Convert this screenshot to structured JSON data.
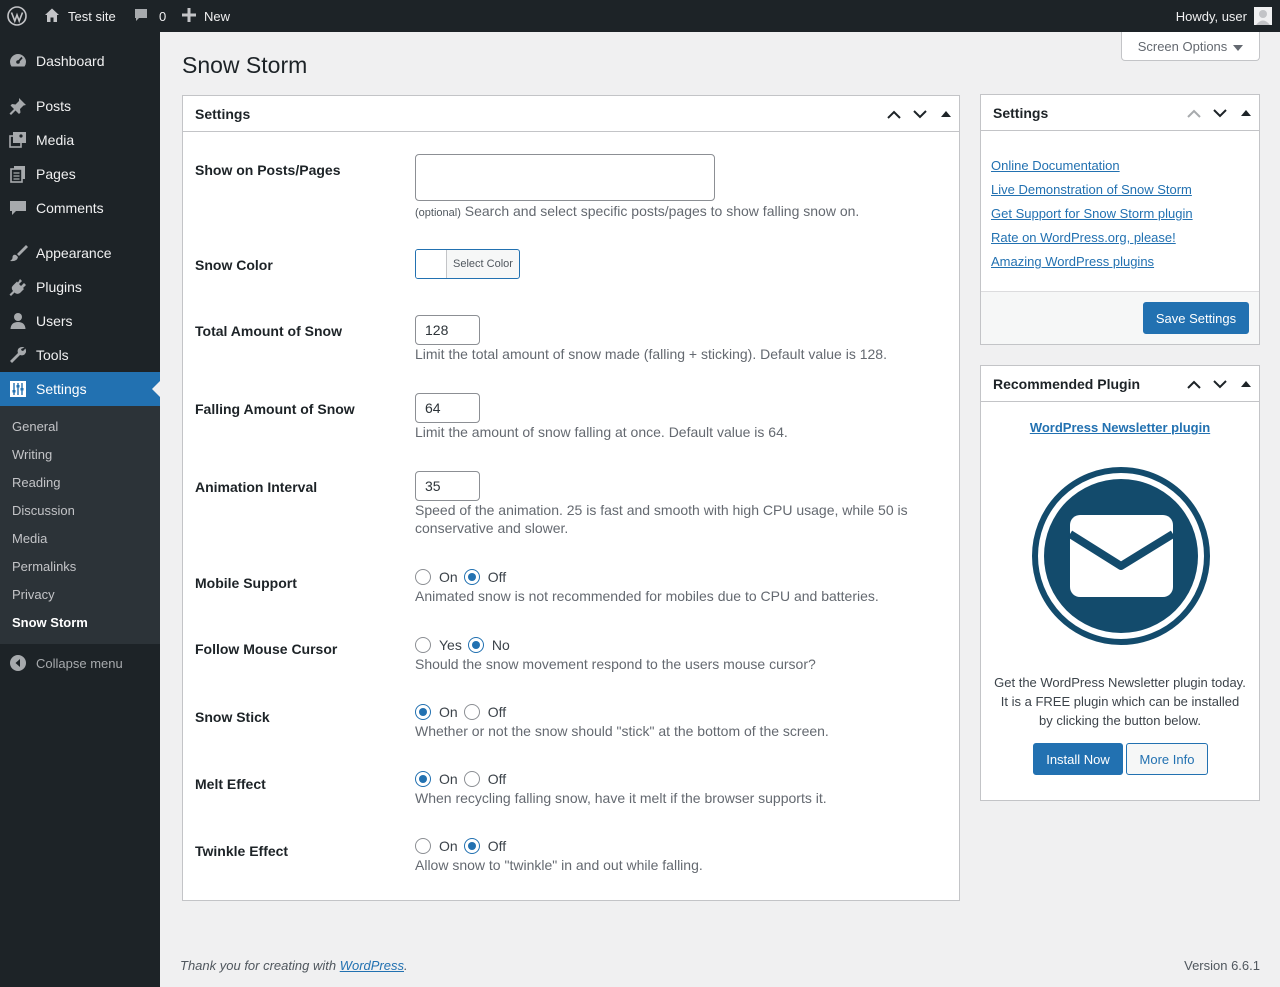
{
  "adminbar": {
    "site_name": "Test site",
    "comments_count": "0",
    "new_label": "New",
    "howdy": "Howdy, user"
  },
  "sidebar": {
    "items": [
      {
        "label": "Dashboard",
        "icon": "dashboard-icon"
      },
      {
        "label": "Posts",
        "icon": "pin-icon"
      },
      {
        "label": "Media",
        "icon": "media-icon"
      },
      {
        "label": "Pages",
        "icon": "pages-icon"
      },
      {
        "label": "Comments",
        "icon": "comment-icon"
      },
      {
        "label": "Appearance",
        "icon": "brush-icon"
      },
      {
        "label": "Plugins",
        "icon": "plug-icon"
      },
      {
        "label": "Users",
        "icon": "user-icon"
      },
      {
        "label": "Tools",
        "icon": "wrench-icon"
      },
      {
        "label": "Settings",
        "icon": "sliders-icon"
      }
    ],
    "submenu": [
      "General",
      "Writing",
      "Reading",
      "Discussion",
      "Media",
      "Permalinks",
      "Privacy",
      "Snow Storm"
    ],
    "collapse_label": "Collapse menu"
  },
  "screen_options": "Screen Options",
  "page_title": "Snow Storm",
  "settings_box": {
    "title": "Settings",
    "show_on_label": "Show on Posts/Pages",
    "show_on_optional": "(optional)",
    "show_on_desc": "Search and select specific posts/pages to show falling snow on.",
    "snow_color_label": "Snow Color",
    "select_color": "Select Color",
    "total_label": "Total Amount of Snow",
    "total_value": "128",
    "total_desc": "Limit the total amount of snow made (falling + sticking). Default value is 128.",
    "falling_label": "Falling Amount of Snow",
    "falling_value": "64",
    "falling_desc": "Limit the amount of snow falling at once. Default value is 64.",
    "interval_label": "Animation Interval",
    "interval_value": "35",
    "interval_desc": "Speed of the animation. 25 is fast and smooth with high CPU usage, while 50 is conservative and slower.",
    "mobile_label": "Mobile Support",
    "mobile_on": "On",
    "mobile_off": "Off",
    "mobile_desc": "Animated snow is not recommended for mobiles due to CPU and batteries.",
    "follow_label": "Follow Mouse Cursor",
    "follow_yes": "Yes",
    "follow_no": "No",
    "follow_desc": "Should the snow movement respond to the users mouse cursor?",
    "stick_label": "Snow Stick",
    "stick_on": "On",
    "stick_off": "Off",
    "stick_desc": "Whether or not the snow should \"stick\" at the bottom of the screen.",
    "melt_label": "Melt Effect",
    "melt_on": "On",
    "melt_off": "Off",
    "melt_desc": "When recycling falling snow, have it melt if the browser supports it.",
    "twinkle_label": "Twinkle Effect",
    "twinkle_on": "On",
    "twinkle_off": "Off",
    "twinkle_desc": "Allow snow to \"twinkle\" in and out while falling."
  },
  "side_settings": {
    "title": "Settings",
    "links": [
      "Online Documentation",
      "Live Demonstration of Snow Storm",
      "Get Support for Snow Storm plugin",
      "Rate on WordPress.org, please!",
      "Amazing WordPress plugins"
    ],
    "save_label": "Save Settings"
  },
  "recommended": {
    "title": "Recommended Plugin",
    "plugin_link": "WordPress Newsletter plugin",
    "desc_line1": "Get the WordPress Newsletter plugin today.",
    "desc_line2": "It is a FREE plugin which can be installed",
    "desc_line3": "by clicking the button below.",
    "install_label": "Install Now",
    "more_label": "More Info"
  },
  "footer": {
    "thanks_prefix": "Thank you for creating with ",
    "wp_link": "WordPress",
    "thanks_suffix": ".",
    "version": "Version 6.6.1"
  },
  "colors": {
    "accent": "#2271b1",
    "sidebar": "#1d2327",
    "newsletter": "#134b6c"
  }
}
